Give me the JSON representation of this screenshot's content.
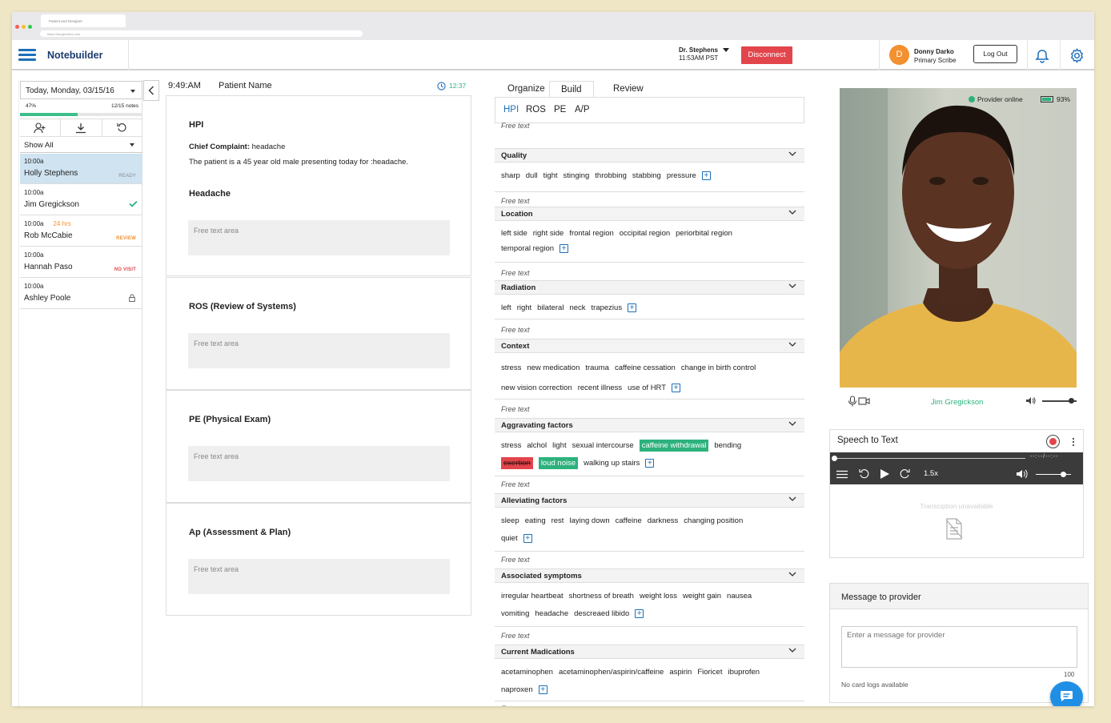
{
  "browser": {
    "tab_title": "Patient and Designer",
    "url": "https://surgicnotes.com"
  },
  "topbar": {
    "brand": "Notebuilder",
    "doctor_name": "Dr. Stephens",
    "doctor_time": "11:53AM PST",
    "disconnect_label": "Disconnect",
    "avatar_initial": "D",
    "user_name": "Donny Darko",
    "user_role": "Primary Scribe",
    "logout_label": "Log Out"
  },
  "sidebar": {
    "date": "Today, Monday, 03/15/16",
    "progress_pct_label": "47%",
    "progress_value": 0.47,
    "notes_count": "12/15 notes",
    "filter": "Show All",
    "patients": [
      {
        "time": "10:00a",
        "extra": "",
        "name": "Holly Stephens",
        "status": "READY"
      },
      {
        "time": "10:00a",
        "extra": "",
        "name": "Jim Gregickson",
        "status": ""
      },
      {
        "time": "10:00a",
        "extra": "24 hrs",
        "name": "Rob McCabie",
        "status": "REVIEW"
      },
      {
        "time": "10:00a",
        "extra": "",
        "name": "Hannah Paso",
        "status": "NO VISIT"
      },
      {
        "time": "10:00a",
        "extra": "",
        "name": "Ashley Poole",
        "status": ""
      }
    ]
  },
  "note": {
    "time": "9:49:AM",
    "patient_label": "Patient Name",
    "timer": "12:37",
    "hpi_title": "HPI",
    "cc_label": "Chief Complaint:",
    "cc_value": " headache",
    "hpi_text": "The patient is a 45 year old male presenting today for :headache.",
    "headache_title": "Headache",
    "ros_title": "ROS (Review of Systems)",
    "pe_title": "PE (Physical Exam)",
    "ap_title": "Ap (Assessment & Plan)",
    "free_text_area": "Free text area"
  },
  "builder": {
    "tabs": [
      "Organize",
      "Build",
      "Review"
    ],
    "subtabs": [
      "HPI",
      "ROS",
      "PE",
      "A/P"
    ],
    "free_text": "Free text",
    "sections": [
      {
        "title": "Quality",
        "tags": [
          "sharp",
          "dull",
          "tight",
          "stinging",
          "throbbing",
          "stabbing",
          "pressure"
        ]
      },
      {
        "title": "Location",
        "tags": [
          "left side",
          "right side",
          "frontal region",
          "occipital region",
          "periorbital region",
          "temporal region"
        ]
      },
      {
        "title": "Radiation",
        "tags": [
          "left",
          "right",
          "bilateral",
          "neck",
          "trapezius"
        ]
      },
      {
        "title": "Context",
        "tags": [
          "stress",
          "new medication",
          "trauma",
          "caffeine cessation",
          "change in birth control",
          "new vision correction",
          "recent illness",
          "use of HRT"
        ]
      },
      {
        "title": "Aggravating factors",
        "tags": [
          "stress",
          "alchol",
          "light",
          "sexual intercourse",
          "caffeine withdrawal",
          "bending",
          "exertion",
          "loud noise",
          "walking up stairs"
        ]
      },
      {
        "title": "Alleviating factors",
        "tags": [
          "sleep",
          "eating",
          "rest",
          "laying down",
          "caffeine",
          "darkness",
          "changing position",
          "quiet"
        ]
      },
      {
        "title": "Associated symptoms",
        "tags": [
          "irregular heartbeat",
          "shortness of breath",
          "weight loss",
          "weight gain",
          "nausea",
          "vomiting",
          "headache",
          "descreaed libido"
        ]
      },
      {
        "title": "Current Madications",
        "tags": [
          "acetaminophen",
          "acetaminophen/aspirin/caffeine",
          "aspirin",
          "Fioricet",
          "ibuprofen",
          "naproxen"
        ]
      }
    ]
  },
  "video": {
    "status": "Provider online",
    "battery": "93%",
    "battery_level": 0.93,
    "caller": "Jim Gregickson"
  },
  "speech": {
    "title": "Speech to Text",
    "time": "--:--/--:--",
    "speed": "1.5x",
    "unavailable": "Transciption unavailable"
  },
  "message": {
    "title": "Message to provider",
    "placeholder": "Enter a message for provider",
    "limit": "100",
    "logs": "No card logs available"
  },
  "colors": {
    "accent": "#1d6fb8",
    "danger": "#e3454c",
    "success": "#2db27d",
    "orange": "#f3902f"
  }
}
